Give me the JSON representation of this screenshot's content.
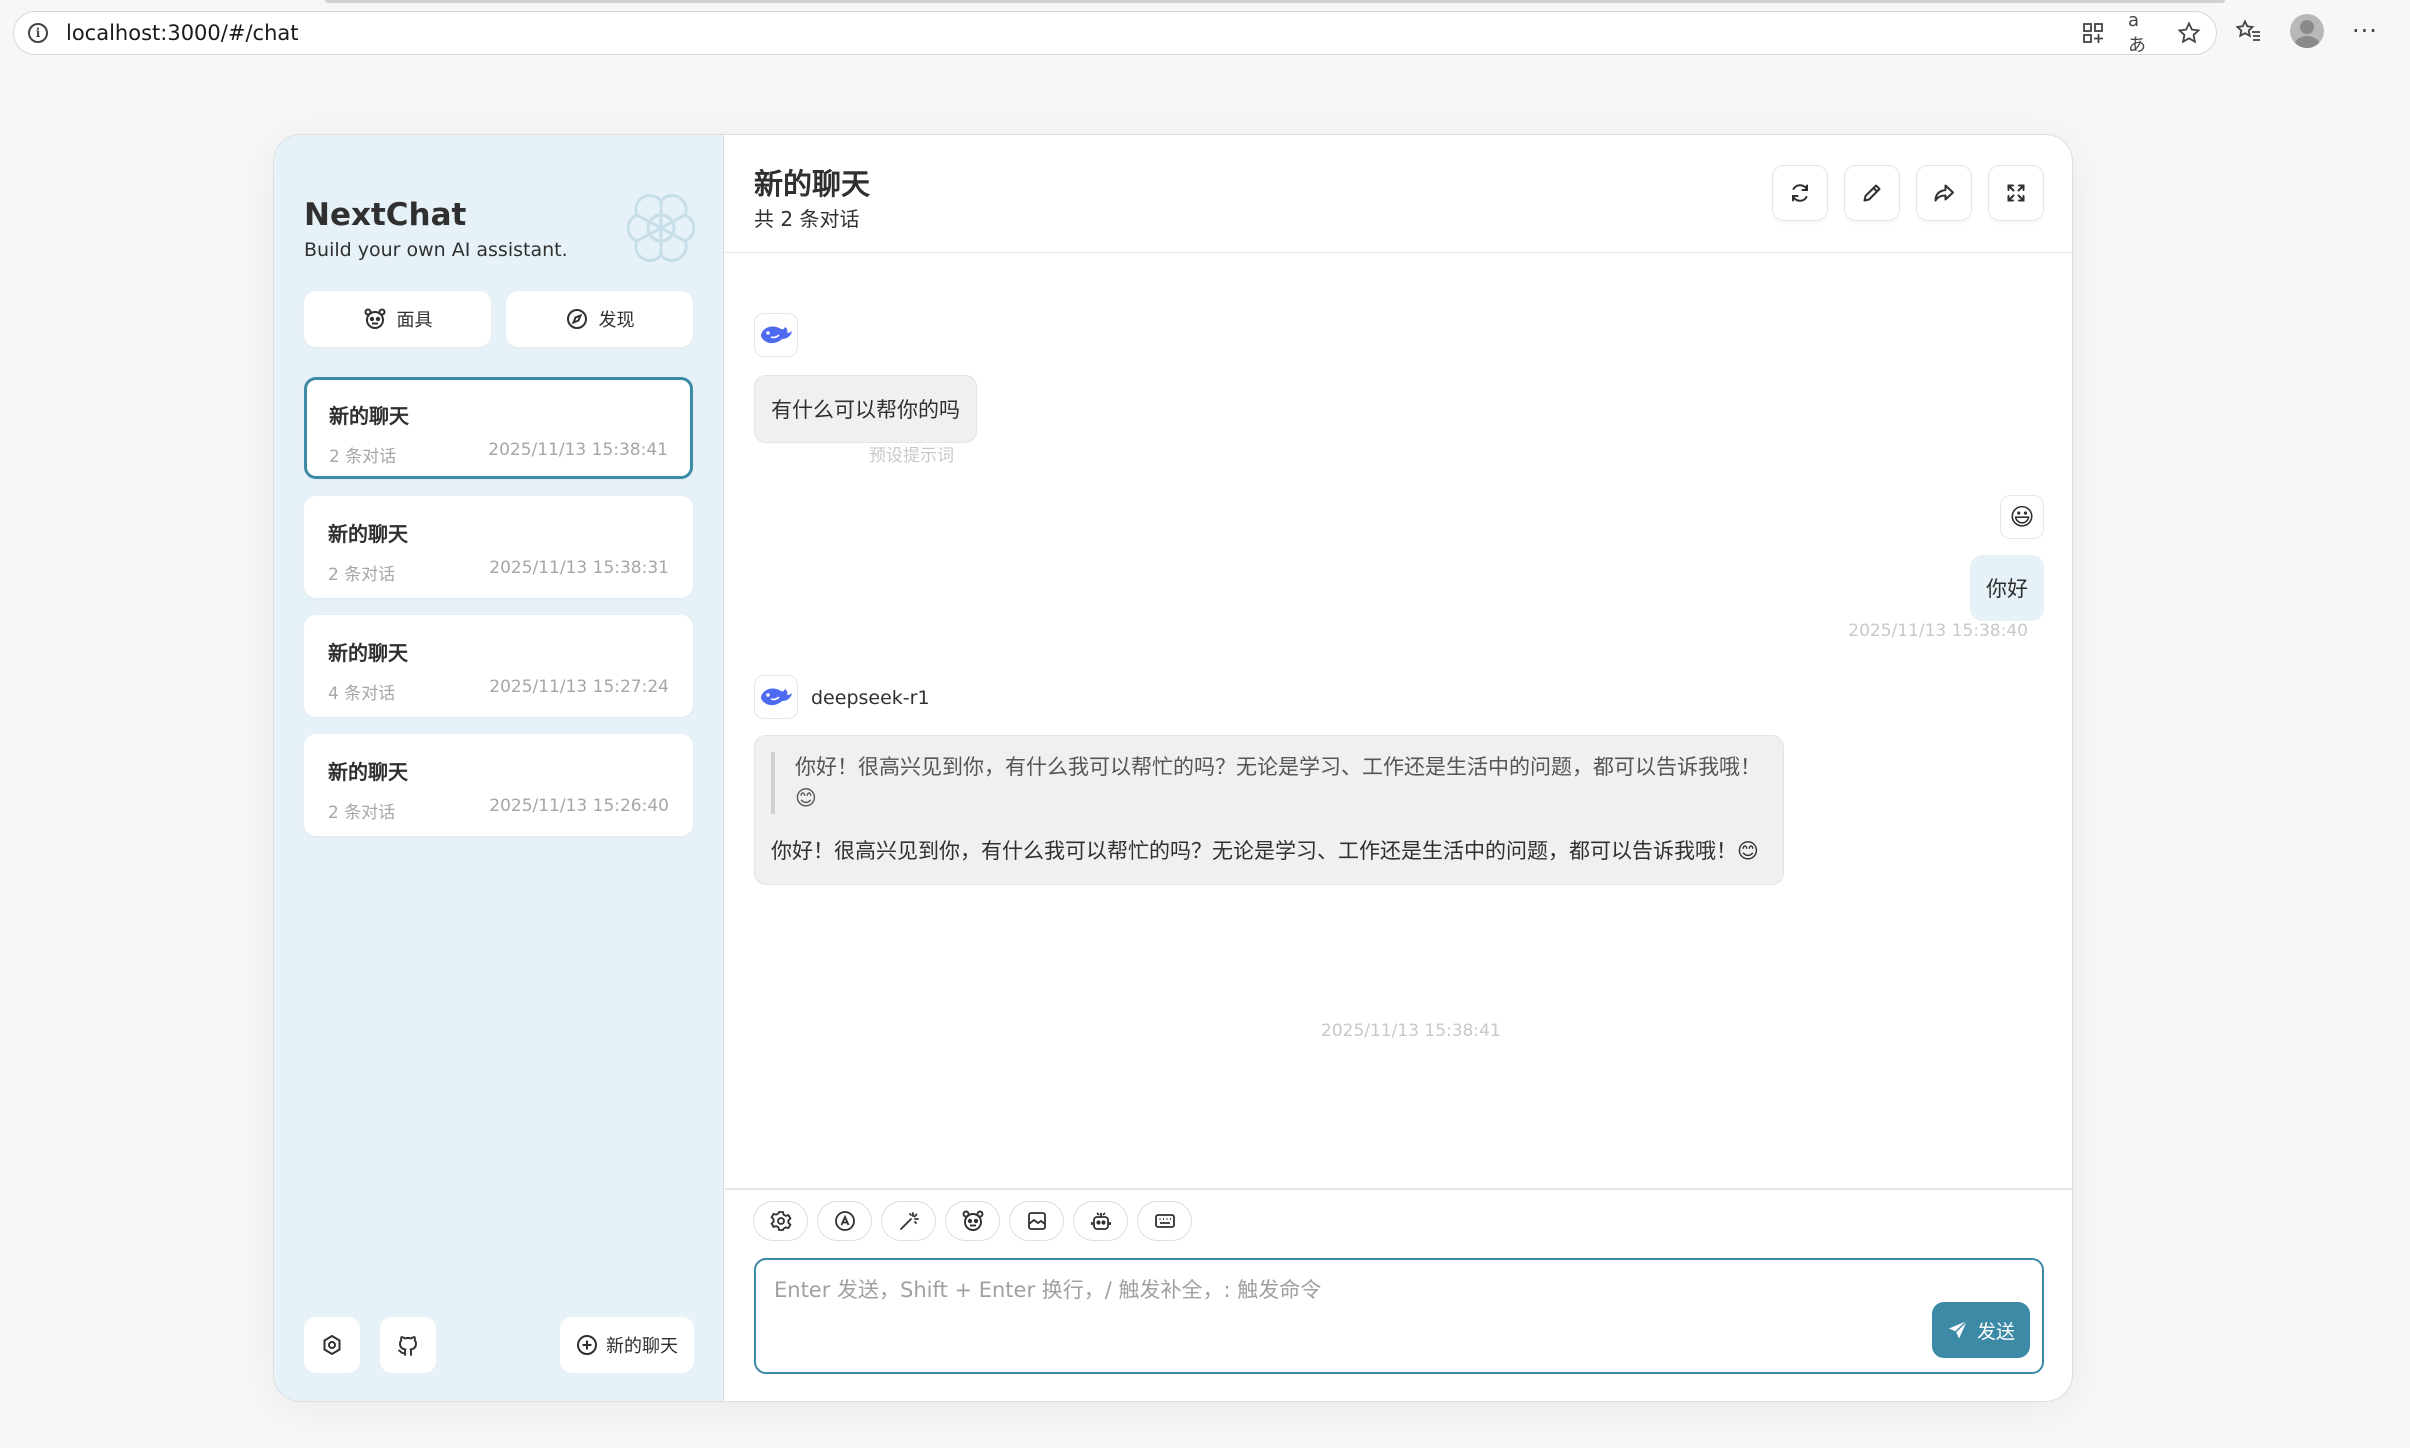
{
  "browser": {
    "url": "localhost:3000/#/chat",
    "icons": [
      "info-icon",
      "app-grid-icon",
      "read-aloud-icon",
      "favorite-star-icon",
      "favorites-list-icon",
      "profile-icon",
      "more-icon"
    ]
  },
  "sidebar": {
    "brand_title": "NextChat",
    "brand_subtitle": "Build your own AI assistant.",
    "mask_button": "面具",
    "discover_button": "发现",
    "chats": [
      {
        "title": "新的聊天",
        "count": "2 条对话",
        "date": "2025/11/13 15:38:41",
        "selected": true
      },
      {
        "title": "新的聊天",
        "count": "2 条对话",
        "date": "2025/11/13 15:38:31",
        "selected": false
      },
      {
        "title": "新的聊天",
        "count": "4 条对话",
        "date": "2025/11/13 15:27:24",
        "selected": false
      },
      {
        "title": "新的聊天",
        "count": "2 条对话",
        "date": "2025/11/13 15:26:40",
        "selected": false
      }
    ],
    "new_chat_button": "新的聊天"
  },
  "header": {
    "title": "新的聊天",
    "subtitle": "共 2 条对话"
  },
  "messages": [
    {
      "role": "assistant",
      "text": "有什么可以帮你的吗",
      "meta": "预设提示词"
    },
    {
      "role": "user",
      "avatar": "😃",
      "text": "你好",
      "meta": "2025/11/13 15:38:40"
    },
    {
      "role": "assistant",
      "model": "deepseek-r1",
      "thinking": "你好！很高兴见到你，有什么我可以帮忙的吗？无论是学习、工作还是生活中的问题，都可以告诉我哦！😊",
      "text": "你好！很高兴见到你，有什么我可以帮忙的吗？无论是学习、工作还是生活中的问题，都可以告诉我哦！😊",
      "meta": "2025/11/13 15:38:41"
    }
  ],
  "input": {
    "placeholder": "Enter 发送，Shift + Enter 换行，/ 触发补全，: 触发命令",
    "send_label": "发送"
  },
  "colors": {
    "accent": "#3c8aa6",
    "sidebar_bg": "#e7f2f8",
    "bubble_bg": "#f0f0f0"
  }
}
